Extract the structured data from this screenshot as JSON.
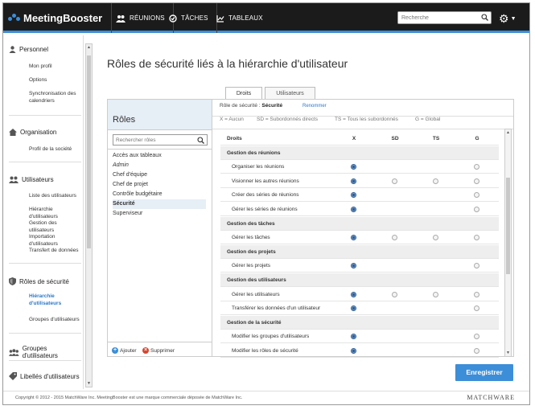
{
  "app": {
    "logo_text": "MeetingBooster",
    "nav": [
      {
        "label": "RÉUNIONS",
        "icon": "people-icon"
      },
      {
        "label": "TÂCHES",
        "icon": "check-circle-icon"
      },
      {
        "label": "TABLEAUX",
        "icon": "chart-icon"
      }
    ],
    "search_placeholder": "Recherche"
  },
  "sidebar": {
    "sections": [
      {
        "title": "Personnel",
        "icon": "user-icon",
        "items": [
          "Mon profil",
          "Options",
          "Synchronisation des calendriers"
        ]
      },
      {
        "title": "Organisation",
        "icon": "home-icon",
        "items": [
          "Profil de la société"
        ]
      },
      {
        "title": "Utilisateurs",
        "icon": "users-icon",
        "items": [
          "Liste des utilisateurs",
          "Hiérarchie d'utilisateurs",
          "Gestion des utilisateurs",
          "Importation d'utilisateurs",
          "Transfert de données"
        ]
      },
      {
        "title": "Rôles de sécurité",
        "icon": "shield-icon",
        "items": [
          "Hiérarchie d'utilisateurs",
          "Groupes d'utilisateurs"
        ]
      },
      {
        "title": "Groupes d'utilisateurs",
        "icon": "group-icon",
        "items": []
      },
      {
        "title": "Libellés d'utilisateurs",
        "icon": "tag-icon",
        "items": []
      }
    ],
    "active_item": "Hiérarchie d'utilisateurs"
  },
  "page": {
    "title": "Rôles de sécurité liés à la hiérarchie d'utilisateur",
    "tabs": [
      {
        "label": "Droits",
        "active": true
      },
      {
        "label": "Utilisateurs",
        "active": false
      }
    ]
  },
  "roles": {
    "title": "Rôles",
    "search_placeholder": "Rechercher rôles",
    "items": [
      {
        "label": "Accès aux tableaux",
        "italic": false,
        "selected": false
      },
      {
        "label": "Admin",
        "italic": true,
        "selected": false
      },
      {
        "label": "Chef d'équipe",
        "italic": false,
        "selected": false
      },
      {
        "label": "Chef de projet",
        "italic": false,
        "selected": false
      },
      {
        "label": "Contrôle budgétaire",
        "italic": false,
        "selected": false
      },
      {
        "label": "Sécurité",
        "italic": false,
        "selected": true
      },
      {
        "label": "Superviseur",
        "italic": false,
        "selected": false
      }
    ],
    "add_label": "Ajouter",
    "delete_label": "Supprimer"
  },
  "rights": {
    "security_role_label": "Rôle de sécurité :",
    "security_role_value": "Sécurité",
    "rename_label": "Renommer",
    "legend": [
      "X = Aucun",
      "SD = Subordonnés directs",
      "TS = Tous les subordonnés",
      "G = Global"
    ],
    "header": {
      "label": "Droits",
      "cols": [
        "X",
        "SD",
        "TS",
        "G"
      ]
    },
    "rows": [
      {
        "type": "group",
        "label": "Gestion des réunions"
      },
      {
        "type": "item",
        "label": "Organiser les réunions",
        "options": [
          "X",
          "G"
        ],
        "selected": "X"
      },
      {
        "type": "item",
        "label": "Visionner les autres réunions",
        "options": [
          "X",
          "SD",
          "TS",
          "G"
        ],
        "selected": "X"
      },
      {
        "type": "item",
        "label": "Créer des séries de réunions",
        "options": [
          "X",
          "G"
        ],
        "selected": "X"
      },
      {
        "type": "item",
        "label": "Gérer les séries de réunions",
        "options": [
          "X",
          "G"
        ],
        "selected": "X"
      },
      {
        "type": "group",
        "label": "Gestion des tâches"
      },
      {
        "type": "item",
        "label": "Gérer les tâches",
        "options": [
          "X",
          "SD",
          "TS",
          "G"
        ],
        "selected": "X"
      },
      {
        "type": "group",
        "label": "Gestion des projets"
      },
      {
        "type": "item",
        "label": "Gérer les projets",
        "options": [
          "X",
          "G"
        ],
        "selected": "X"
      },
      {
        "type": "group",
        "label": "Gestion des utilisateurs"
      },
      {
        "type": "item",
        "label": "Gérer les utilisateurs",
        "options": [
          "X",
          "SD",
          "TS",
          "G"
        ],
        "selected": "X"
      },
      {
        "type": "item",
        "label": "Transférer les données d'un utilisateur",
        "options": [
          "X",
          "G"
        ],
        "selected": "X"
      },
      {
        "type": "group",
        "label": "Gestion de la sécurité"
      },
      {
        "type": "item",
        "label": "Modifier les groupes d'utilisateurs",
        "options": [
          "X",
          "G"
        ],
        "selected": "X"
      },
      {
        "type": "item",
        "label": "Modifier les rôles de sécurité",
        "options": [
          "X",
          "G"
        ],
        "selected": "X"
      }
    ]
  },
  "save_label": "Enregistrer",
  "footer": {
    "copyright": "Copyright © 2012 - 2015 MatchWare Inc. MeetingBooster est une marque commerciale déposée de MatchWare Inc.",
    "brand": "MATCHWARE"
  }
}
